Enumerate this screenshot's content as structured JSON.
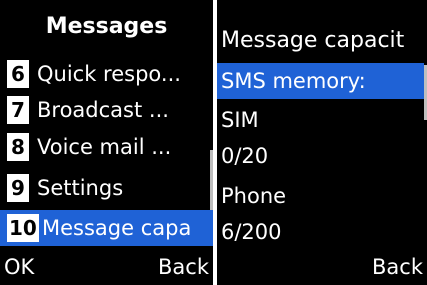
{
  "left": {
    "title": "Messages",
    "items": [
      {
        "num": "6",
        "label": "Quick respo..."
      },
      {
        "num": "7",
        "label": "Broadcast ..."
      },
      {
        "num": "8",
        "label": "Voice mail ..."
      },
      {
        "num": "9",
        "label": "Settings"
      },
      {
        "num": "10",
        "label": "Message capa"
      }
    ],
    "softkey_left": "OK",
    "softkey_right": "Back"
  },
  "right": {
    "title": "Message capacit",
    "selected_label": "SMS memory:",
    "sim_label": "SIM",
    "sim_value": "0/20",
    "phone_label": "Phone",
    "phone_value": "6/200",
    "softkey_right": "Back"
  },
  "colors": {
    "highlight": "#1f62d6",
    "background": "#000000",
    "text": "#ffffff"
  }
}
